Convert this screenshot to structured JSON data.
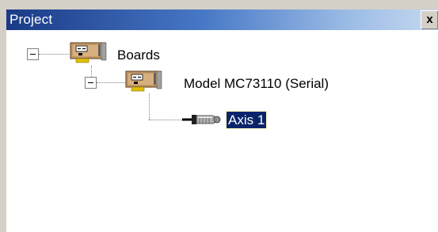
{
  "panel": {
    "title": "Project",
    "close_label": "x"
  },
  "tree": {
    "root": {
      "label": "Boards",
      "icon": "board-icon"
    },
    "board": {
      "label": "Model MC73110 (Serial)",
      "icon": "board-icon"
    },
    "axis": {
      "label": "Axis 1",
      "icon": "axis-connector-icon",
      "selected": true
    }
  },
  "colors": {
    "titlebar_start": "#1a3a86",
    "titlebar_end": "#c6d8ef",
    "selection": "#0a246a"
  }
}
